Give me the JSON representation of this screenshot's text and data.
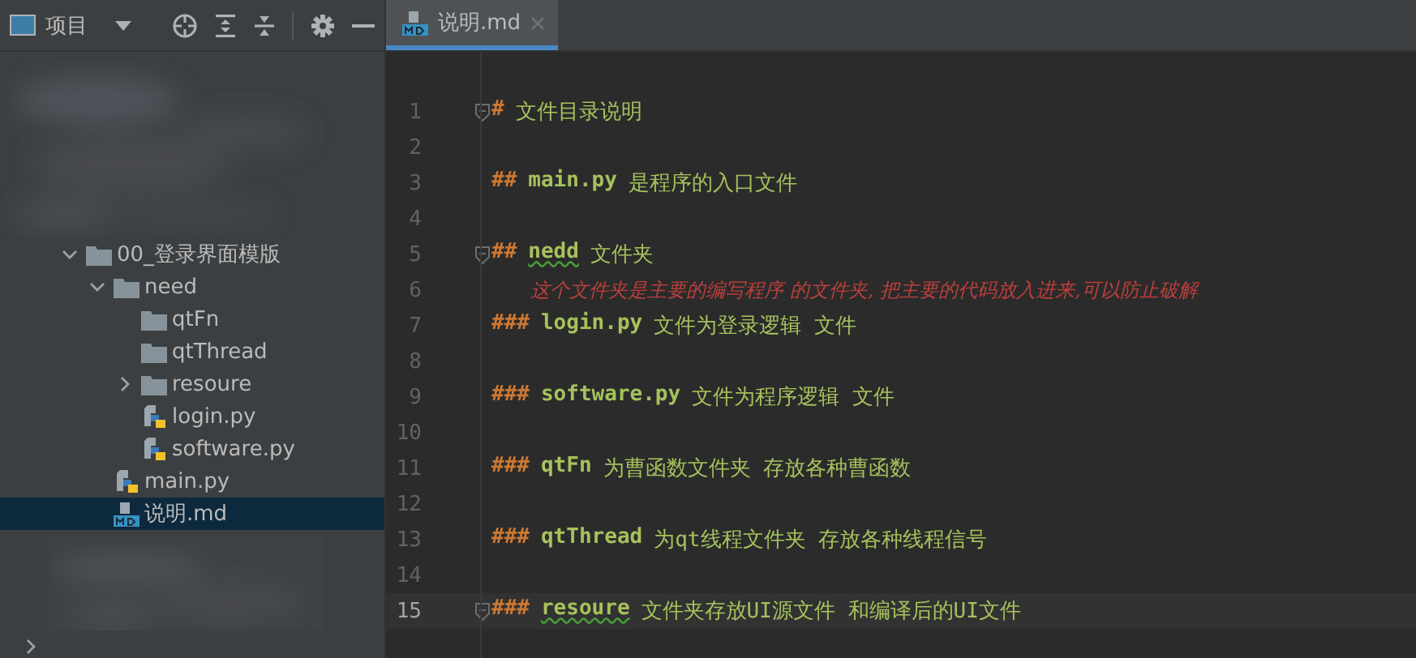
{
  "project_bar": {
    "title": "项目"
  },
  "tree": [
    {
      "label": "00_登录界面模版",
      "kind": "folder",
      "expanded": true,
      "selected": false,
      "children": [
        {
          "label": "need",
          "kind": "folder",
          "expanded": true,
          "selected": false,
          "children": [
            {
              "label": "qtFn",
              "kind": "folder",
              "selected": false
            },
            {
              "label": "qtThread",
              "kind": "folder",
              "selected": false
            },
            {
              "label": "resoure",
              "kind": "folder",
              "expanded": false,
              "selected": false
            },
            {
              "label": "login.py",
              "kind": "python",
              "selected": false
            },
            {
              "label": "software.py",
              "kind": "python",
              "selected": false
            }
          ]
        },
        {
          "label": "main.py",
          "kind": "python",
          "selected": false
        },
        {
          "label": "说明.md",
          "kind": "markdown",
          "selected": true
        }
      ]
    }
  ],
  "tab": {
    "label": "说明.md",
    "selected": true
  },
  "lines": [
    {
      "number": "1",
      "kind": "heading",
      "marker": "#",
      "text": "文件目录说明",
      "fold": true,
      "current": false
    },
    {
      "number": "2",
      "kind": "blank",
      "current": false
    },
    {
      "number": "3",
      "kind": "heading",
      "marker": "##",
      "code": "main.py",
      "text": "是程序的入口文件",
      "current": false
    },
    {
      "number": "4",
      "kind": "blank",
      "current": false
    },
    {
      "number": "5",
      "kind": "heading",
      "marker": "##",
      "code": "nedd",
      "typo": true,
      "text": "文件夹",
      "fold": true,
      "current": false
    },
    {
      "number": "6",
      "kind": "comment",
      "text": "这个文件夹是主要的编写程序 的文件夹, 把主要的代码放入进来,可以防止破解",
      "current": false
    },
    {
      "number": "7",
      "kind": "heading",
      "marker": "###",
      "code": "login.py",
      "text": "文件为登录逻辑 文件",
      "current": false
    },
    {
      "number": "8",
      "kind": "blank",
      "current": false
    },
    {
      "number": "9",
      "kind": "heading",
      "marker": "###",
      "code": "software.py",
      "text": "文件为程序逻辑 文件",
      "current": false
    },
    {
      "number": "10",
      "kind": "blank",
      "current": false
    },
    {
      "number": "11",
      "kind": "heading",
      "marker": "###",
      "code": "qtFn",
      "text": "为曹函数文件夹 存放各种曹函数",
      "current": false
    },
    {
      "number": "12",
      "kind": "blank",
      "current": false
    },
    {
      "number": "13",
      "kind": "heading",
      "marker": "###",
      "code": "qtThread",
      "text": "为qt线程文件夹 存放各种线程信号",
      "current": false
    },
    {
      "number": "14",
      "kind": "blank",
      "current": false
    },
    {
      "number": "15",
      "kind": "heading",
      "marker": "###",
      "code": "resoure",
      "typo": true,
      "text": "文件夹存放UI源文件 和编译后的UI文件",
      "fold": true,
      "current": true
    }
  ]
}
